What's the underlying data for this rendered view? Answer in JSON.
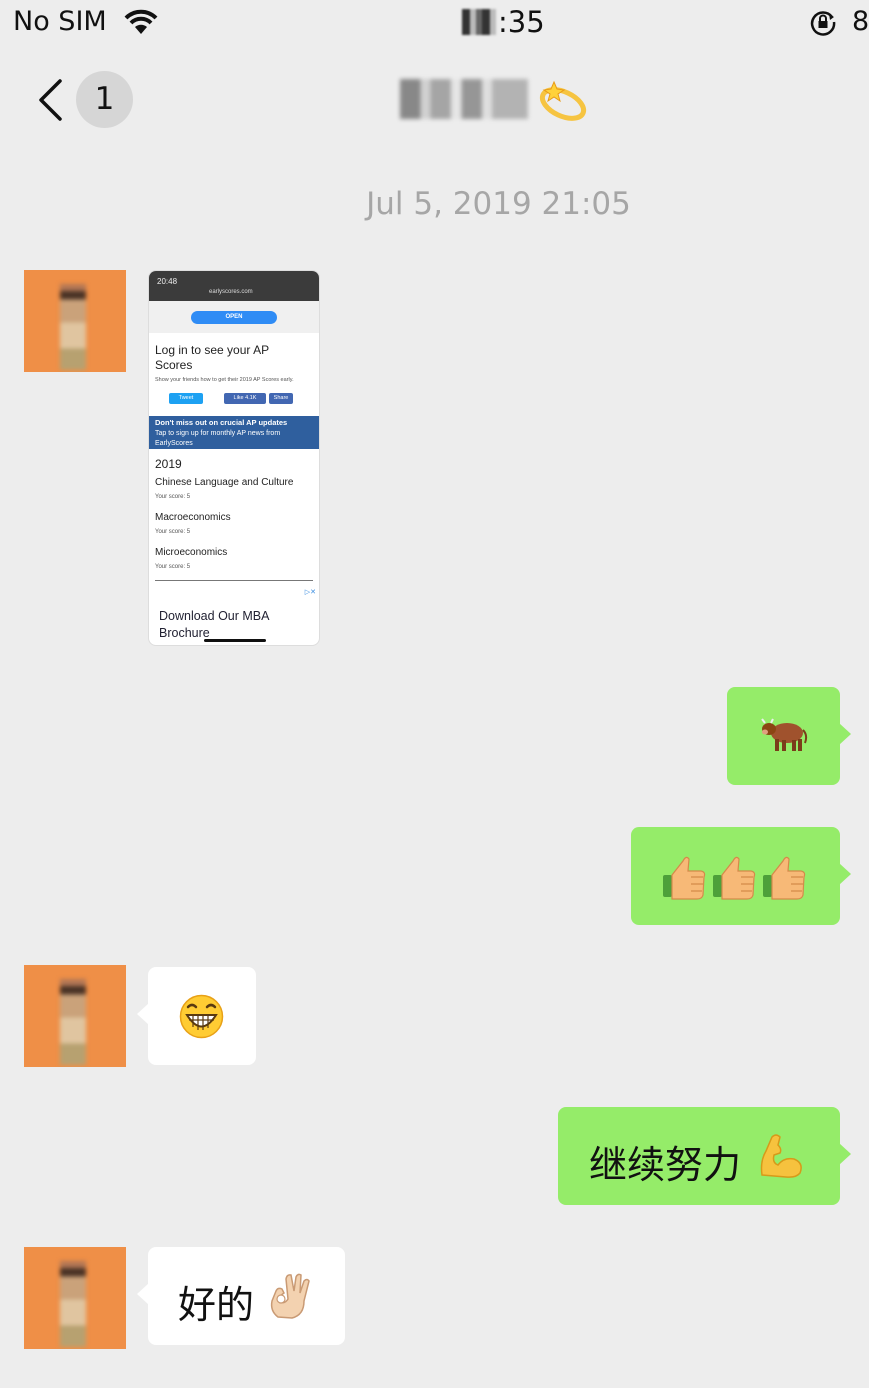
{
  "status_bar": {
    "carrier": "No SIM",
    "time": "35",
    "battery": "8"
  },
  "nav": {
    "unread_count": "1",
    "contact_name": "",
    "icons": {
      "back": "chevron-left-icon",
      "title_emoji": "dizzy-emoji-icon"
    }
  },
  "chat": {
    "timestamp": "Jul 5, 2019 21:05",
    "screenshot_message": {
      "status_time": "20:48",
      "url": "earlyscores.com",
      "open_label": "OPEN",
      "heading": "Log in to see your AP Scores",
      "subtext": "Show your friends how to get their 2019 AP Scores early.",
      "tweet_label": "Tweet",
      "like_label": "Like 4.1K",
      "share_label": "Share",
      "banner_title": "Don't miss out on crucial AP updates",
      "banner_text": "Tap to sign up for monthly AP news from EarlyScores",
      "year": "2019",
      "subjects": [
        {
          "name": "Chinese Language and Culture",
          "score": "Your score: 5"
        },
        {
          "name": "Macroeconomics",
          "score": "Your score: 5"
        },
        {
          "name": "Microeconomics",
          "score": "Your score: 5"
        }
      ],
      "ad_text": "Download Our MBA Brochure"
    },
    "messages": [
      {
        "from": "me",
        "emoji": "cow-emoji"
      },
      {
        "from": "me",
        "emoji": "thumbs-up-emoji x3"
      },
      {
        "from": "them",
        "emoji": "grinning-sticker"
      },
      {
        "from": "me",
        "text": "继续努力",
        "emoji": "flexed-biceps-emoji"
      },
      {
        "from": "them",
        "text": "好的",
        "emoji": "ok-hand-emoji"
      }
    ]
  },
  "colors": {
    "background": "#ededed",
    "sent_bubble": "#95ec69",
    "received_bubble": "#ffffff",
    "avatar": "#ef8f47"
  }
}
